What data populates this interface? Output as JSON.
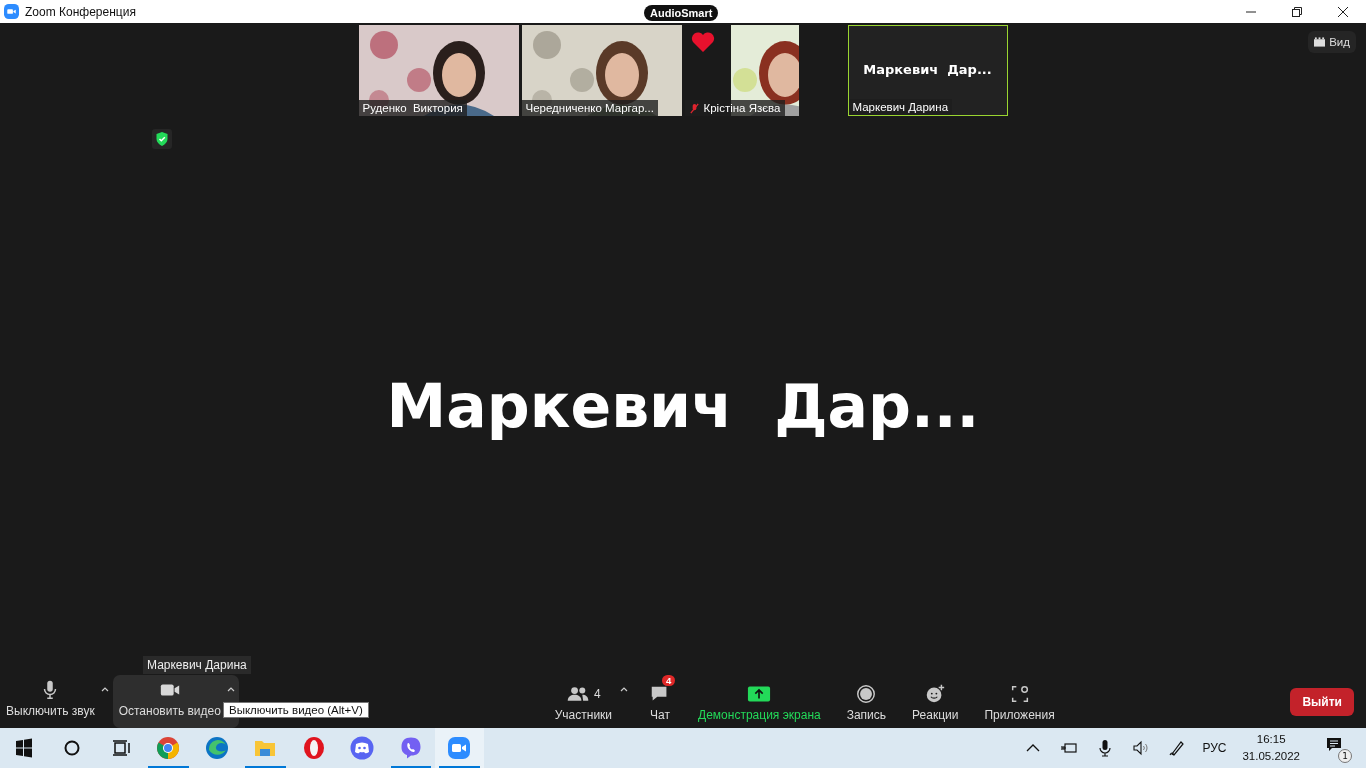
{
  "window": {
    "title": "Zoom Конференция"
  },
  "badge": "AudioSmart",
  "view_button": "Вид",
  "thumbnails": [
    {
      "kind": "video",
      "name": "Руденко  Виктория",
      "muted": false,
      "selected": false,
      "reaction": false
    },
    {
      "kind": "video",
      "name": "Чередниченко Маргар...",
      "muted": false,
      "selected": false,
      "reaction": false
    },
    {
      "kind": "video_small",
      "name": "Крістіна Язєва",
      "muted": true,
      "selected": false,
      "reaction": true
    },
    {
      "kind": "avatar",
      "display_name": "Маркевич  Дар...",
      "name": "Маркевич Дарина",
      "muted": false,
      "selected": true,
      "reaction": false
    }
  ],
  "main": {
    "speaker": "Маркевич  Дар..."
  },
  "name_tooltip": "Маркевич Дарина",
  "toolbar_left": [
    {
      "kind": "mic",
      "label": "Выключить звук",
      "hovered": false
    },
    {
      "kind": "video",
      "label": "Остановить видео",
      "hovered": true
    }
  ],
  "toolbar_center": [
    {
      "kind": "participants",
      "label": "Участники",
      "count": "4"
    },
    {
      "kind": "chat",
      "label": "Чат",
      "badge": "4"
    },
    {
      "kind": "share",
      "label": "Демонстрация экрана"
    },
    {
      "kind": "record",
      "label": "Запись"
    },
    {
      "kind": "reactions",
      "label": "Реакции"
    },
    {
      "kind": "apps",
      "label": "Приложения"
    }
  ],
  "hint": "Выключить видео (Alt+V)",
  "leave_button": "Выйти",
  "taskbar": {
    "apps": [
      {
        "kind": "chrome",
        "running": true,
        "selected": false
      },
      {
        "kind": "edge",
        "running": false,
        "selected": false
      },
      {
        "kind": "explorer",
        "running": true,
        "selected": false
      },
      {
        "kind": "opera",
        "running": false,
        "selected": false
      },
      {
        "kind": "discord",
        "running": false,
        "selected": false
      },
      {
        "kind": "viber",
        "running": true,
        "selected": false
      },
      {
        "kind": "zoom",
        "running": true,
        "selected": true
      }
    ],
    "language": "РУС",
    "time": "16:15",
    "date": "31.05.2022",
    "notifications": "1"
  }
}
